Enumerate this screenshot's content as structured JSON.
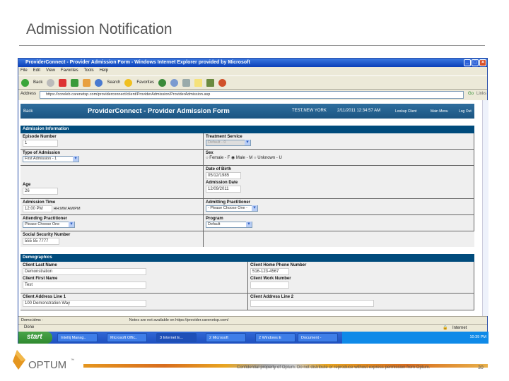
{
  "slide": {
    "title": "Admission Notification",
    "confidential": "Confidential property of Optum. Do not distribute or reproduce without express permission from Optum.",
    "page_number": "30",
    "logo_text": "OPTUM",
    "logo_tm": "™"
  },
  "browser": {
    "title": "ProviderConnect - Provider Admission Form - Windows Internet Explorer provided by Microsoft",
    "menu": [
      "File",
      "Edit",
      "View",
      "Favorites",
      "Tools",
      "Help"
    ],
    "toolbar": {
      "back": "Back",
      "search": "Search",
      "favorites": "Favorites"
    },
    "address_label": "Address",
    "address": "https://coreleb.carenetsp.com/providerconnect/client/ProviderAdmission/ProviderAdmission.asp",
    "go": "Go",
    "links": "Links",
    "links_bar": "Demo.idms ·",
    "links_message": "Notes are not available on https://provider.carenetsp.com/",
    "status": "Done",
    "zone": "Internet",
    "taskbar": {
      "start": "start",
      "tasks": [
        "Intellij Manag..",
        "Microsoft Offic..",
        "3 Internet E...",
        "2 Microsoft",
        "2 Windows E",
        "Document -"
      ],
      "clock": "10:39 PM"
    }
  },
  "page": {
    "back": "Back",
    "title": "ProviderConnect - Provider Admission Form",
    "user": "TEST,NEW YORK",
    "datetime": "2/11/2011 12:34:57 AM",
    "nav": [
      "Lookup Client",
      "Main Menu",
      "Log Out"
    ],
    "admission": {
      "header": "Admission Information",
      "episode_label": "Episode Number",
      "episode": "1",
      "treatment_label": "Treatment Service",
      "treatment": "Default - 0",
      "type_label": "Type of Admission",
      "type": "First Admission - 1",
      "sex_label": "Sex",
      "sex_options": [
        "Female - F",
        "Male - M",
        "Unknown - U"
      ],
      "sex_selected": "Male - M",
      "dob_label": "Date of Birth",
      "dob": "05/12/1985",
      "age_label": "Age",
      "age": "26",
      "admdate_label": "Admission Date",
      "admdate": "12/09/2011",
      "time_label": "Admission Time",
      "time": "12:00 PM",
      "time_hint": "HH:MM AM/PM",
      "admitting_label": "Admitting Practitioner",
      "admitting": "- Please Choose One -",
      "attending_label": "Attending Practitioner",
      "attending": "Please Choose One",
      "program_label": "Program",
      "program": "Default",
      "ssn_label": "Social Security Number",
      "ssn": "555 55 7777"
    },
    "demographics": {
      "header": "Demographics",
      "last_label": "Client Last Name",
      "last": "Demonstration",
      "home_label": "Client Home Phone Number",
      "home": "516-123-4567",
      "first_label": "Client First Name",
      "first": "Test",
      "work_label": "Client Work Number",
      "work": "",
      "addr1_label": "Client Address Line 1",
      "addr1": "100 Demonstration Way",
      "addr2_label": "Client Address Line 2",
      "addr2": ""
    }
  },
  "colors": {
    "section_header": "#004b7c",
    "title_bar": "#0a3fb8",
    "optum_orange": "#e5961f"
  }
}
